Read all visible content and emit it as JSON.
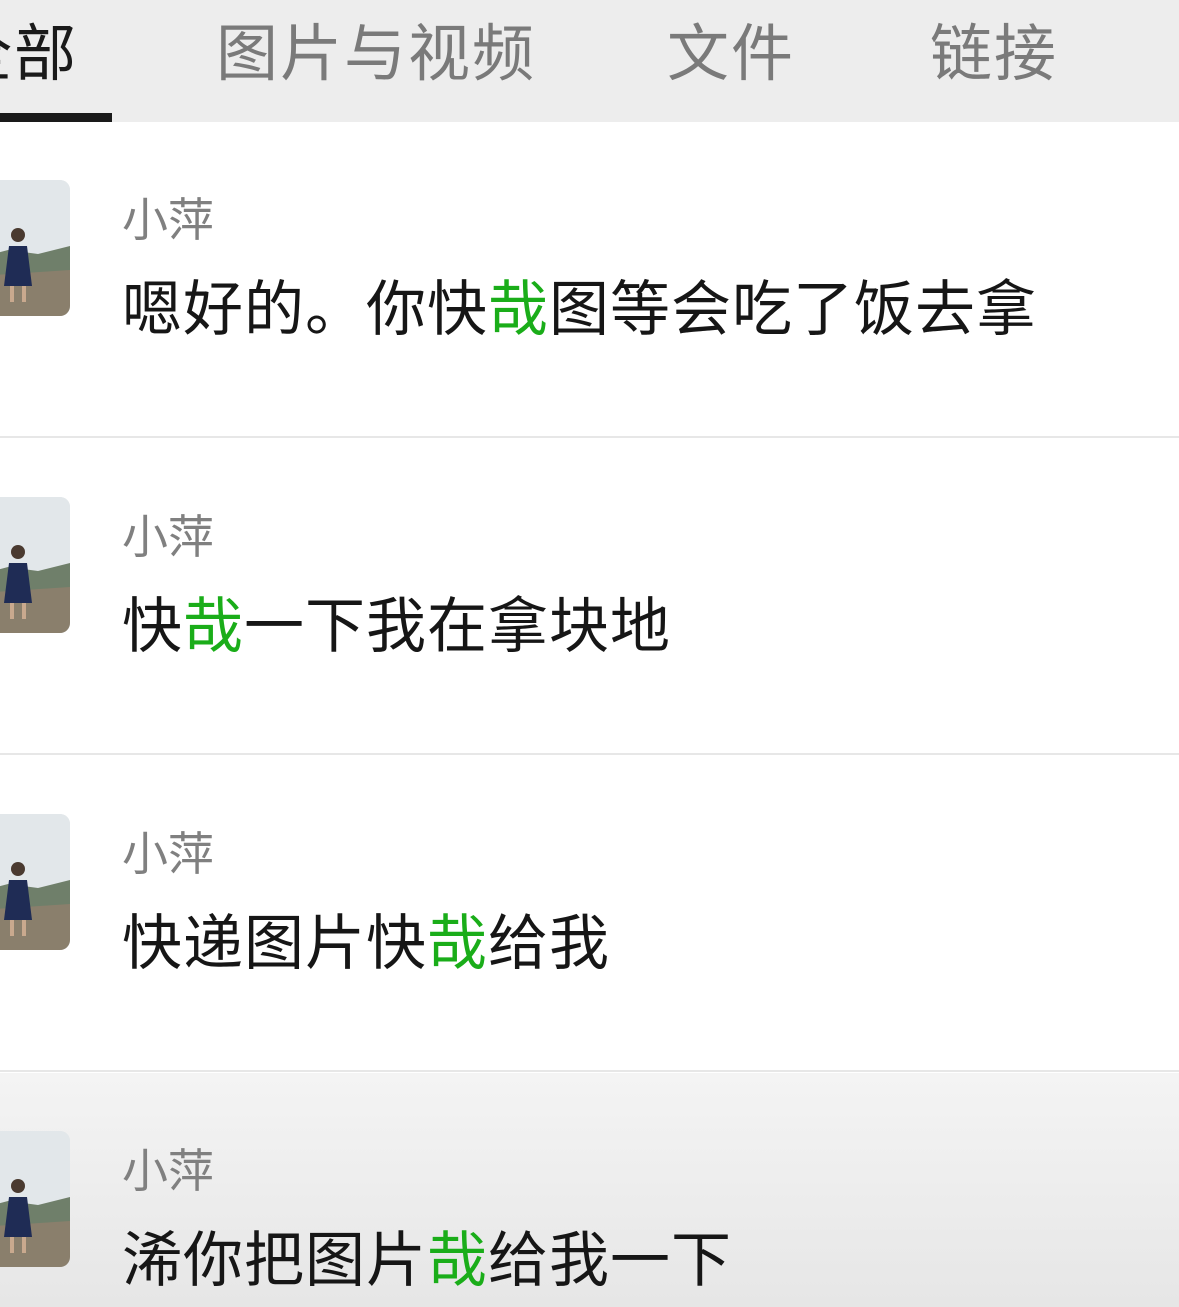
{
  "tabs": [
    {
      "label": "全部",
      "active": true
    },
    {
      "label": "图片与视频",
      "active": false
    },
    {
      "label": "文件",
      "active": false
    },
    {
      "label": "链接",
      "active": false
    }
  ],
  "highlight_color": "#1aad19",
  "results": [
    {
      "sender": "小萍",
      "avatar": "profile-photo",
      "message": {
        "before": "嗯好的。你快",
        "match": "哉",
        "after": "图等会吃了饭去拿"
      }
    },
    {
      "sender": "小萍",
      "avatar": "profile-photo",
      "message": {
        "before": "快",
        "match": "哉",
        "after": "一下我在拿块地"
      }
    },
    {
      "sender": "小萍",
      "avatar": "profile-photo",
      "message": {
        "before": "快递图片快",
        "match": "哉",
        "after": "给我"
      }
    },
    {
      "sender": "小萍",
      "avatar": "profile-photo",
      "message": {
        "before": "浠你把图片",
        "match": "哉",
        "after": "给我一下"
      }
    }
  ]
}
